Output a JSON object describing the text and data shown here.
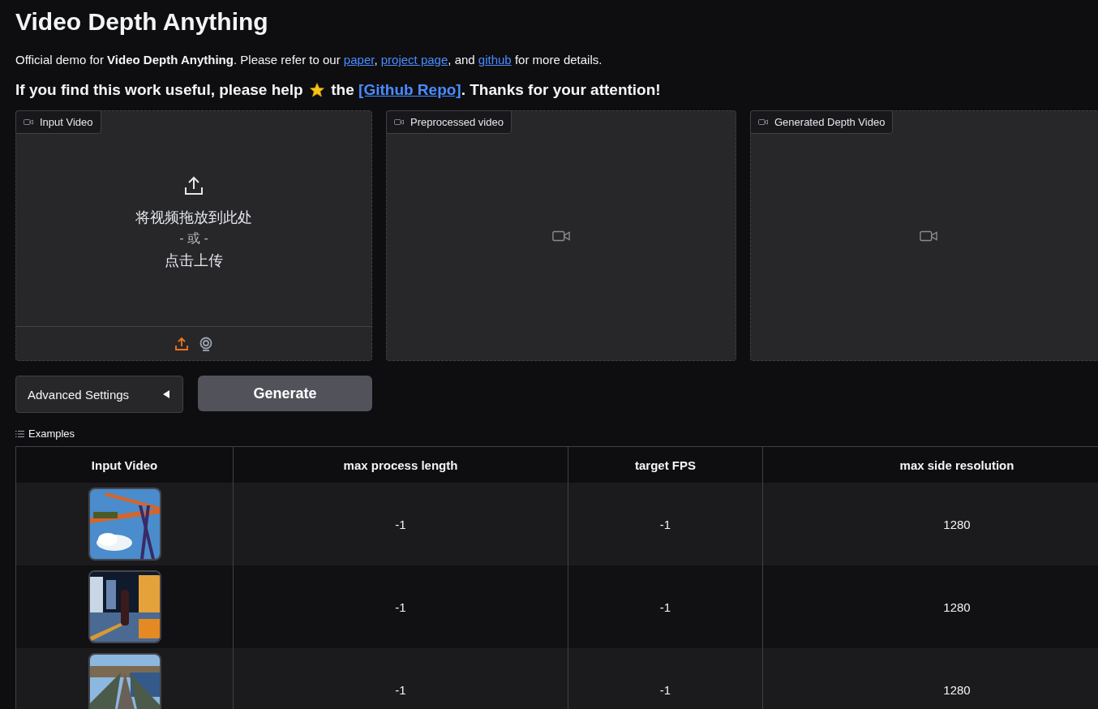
{
  "title": "Video Depth Anything",
  "intro": [
    {
      "kind": "text",
      "text": "Official demo for **Video Depth Anything**. Please refer to our "
    },
    {
      "kind": "link",
      "text": "paper"
    },
    {
      "kind": "text",
      "text": ", "
    },
    {
      "kind": "link",
      "text": "project page"
    },
    {
      "kind": "text",
      "text": ", and "
    },
    {
      "kind": "link",
      "text": "github"
    },
    {
      "kind": "text",
      "text": " for more details."
    }
  ],
  "call_to_action": [
    {
      "kind": "text",
      "text": "If you find this work useful, please help "
    },
    {
      "kind": "star"
    },
    {
      "kind": "text",
      "text": " the "
    },
    {
      "kind": "link",
      "text": "[Github Repo]"
    },
    {
      "kind": "text",
      "text": ". Thanks for your attention!"
    }
  ],
  "panels": [
    {
      "kind": "upload",
      "label": "Input Video",
      "drop_text": "将视频拖放到此处",
      "or_text": "- 或 -",
      "click_text": "点击上传",
      "sources": [
        {
          "kind": "upload",
          "selected": true
        },
        {
          "kind": "webcam",
          "selected": false
        }
      ]
    },
    {
      "kind": "output",
      "label": "Preprocessed video"
    },
    {
      "kind": "output",
      "label": "Generated Depth Video"
    }
  ],
  "advanced_settings": {
    "label": "Advanced Settings",
    "expanded": false
  },
  "generate_button": "Generate",
  "examples": {
    "label": "Examples",
    "columns": [
      "Input Video",
      "max process length",
      "target FPS",
      "max side resolution"
    ],
    "rows": [
      {
        "cells": [
          {
            "kind": "picture"
          },
          "-1",
          "-1",
          "1280"
        ]
      },
      {
        "cells": [
          {
            "kind": "picture"
          },
          "-1",
          "-1",
          "1280"
        ]
      },
      {
        "cells": [
          {
            "kind": "picture"
          },
          "-1",
          "-1",
          "1280"
        ]
      }
    ]
  }
}
